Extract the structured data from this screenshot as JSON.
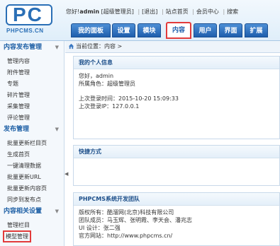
{
  "logo": {
    "mark": "PC",
    "text": "PHPCMS.CN"
  },
  "userbar": {
    "greeting_prefix": "您好!",
    "username": "admin",
    "role": "[超级管理员]",
    "logout": "[退出]",
    "site_home": "站点首页",
    "member_center": "会员中心",
    "search": "搜索"
  },
  "nav": {
    "tabs": [
      "我的面板",
      "设置",
      "模块",
      "内容",
      "用户",
      "界面",
      "扩展"
    ],
    "active": "内容"
  },
  "breadcrumb": {
    "text": "当前位置：内容 >"
  },
  "sidebar": {
    "sections": [
      {
        "title": "内容发布管理",
        "items": [
          "管理内容",
          "附件管理",
          "专题",
          "碎片管理",
          "采集管理",
          "评论管理"
        ]
      },
      {
        "title": "发布管理",
        "items": [
          "批量更新栏目页",
          "生成首页",
          "一键清理数据",
          "批量更新URL",
          "批量更新内容页",
          "同步到发布点"
        ]
      },
      {
        "title": "内容相关设置",
        "items": [
          "管理栏目",
          "模型管理"
        ]
      }
    ],
    "highlighted_item": "模型管理"
  },
  "panels": {
    "personal": {
      "title": "我的个人信息",
      "hello": "您好，admin",
      "role": "所属角色：超级管理员",
      "last_login_time": "上次登录时间：2015-10-20 15:09:33",
      "last_login_ip": "上次登录IP：127.0.0.1"
    },
    "shortcuts": {
      "title": "快捷方式"
    },
    "team": {
      "title": "PHPCMS系统开发团队",
      "copyright": "版权所有：酷溜网(北京)科技有限公司",
      "members": "团队成员：马玉辉、张明霞、李天会、潘兆志",
      "ui": "UI 设计：张二强",
      "website": "官方网站：http://www.phpcms.cn/"
    }
  },
  "colors": {
    "accent": "#1f5fad",
    "highlight_border": "#e23b3b"
  }
}
